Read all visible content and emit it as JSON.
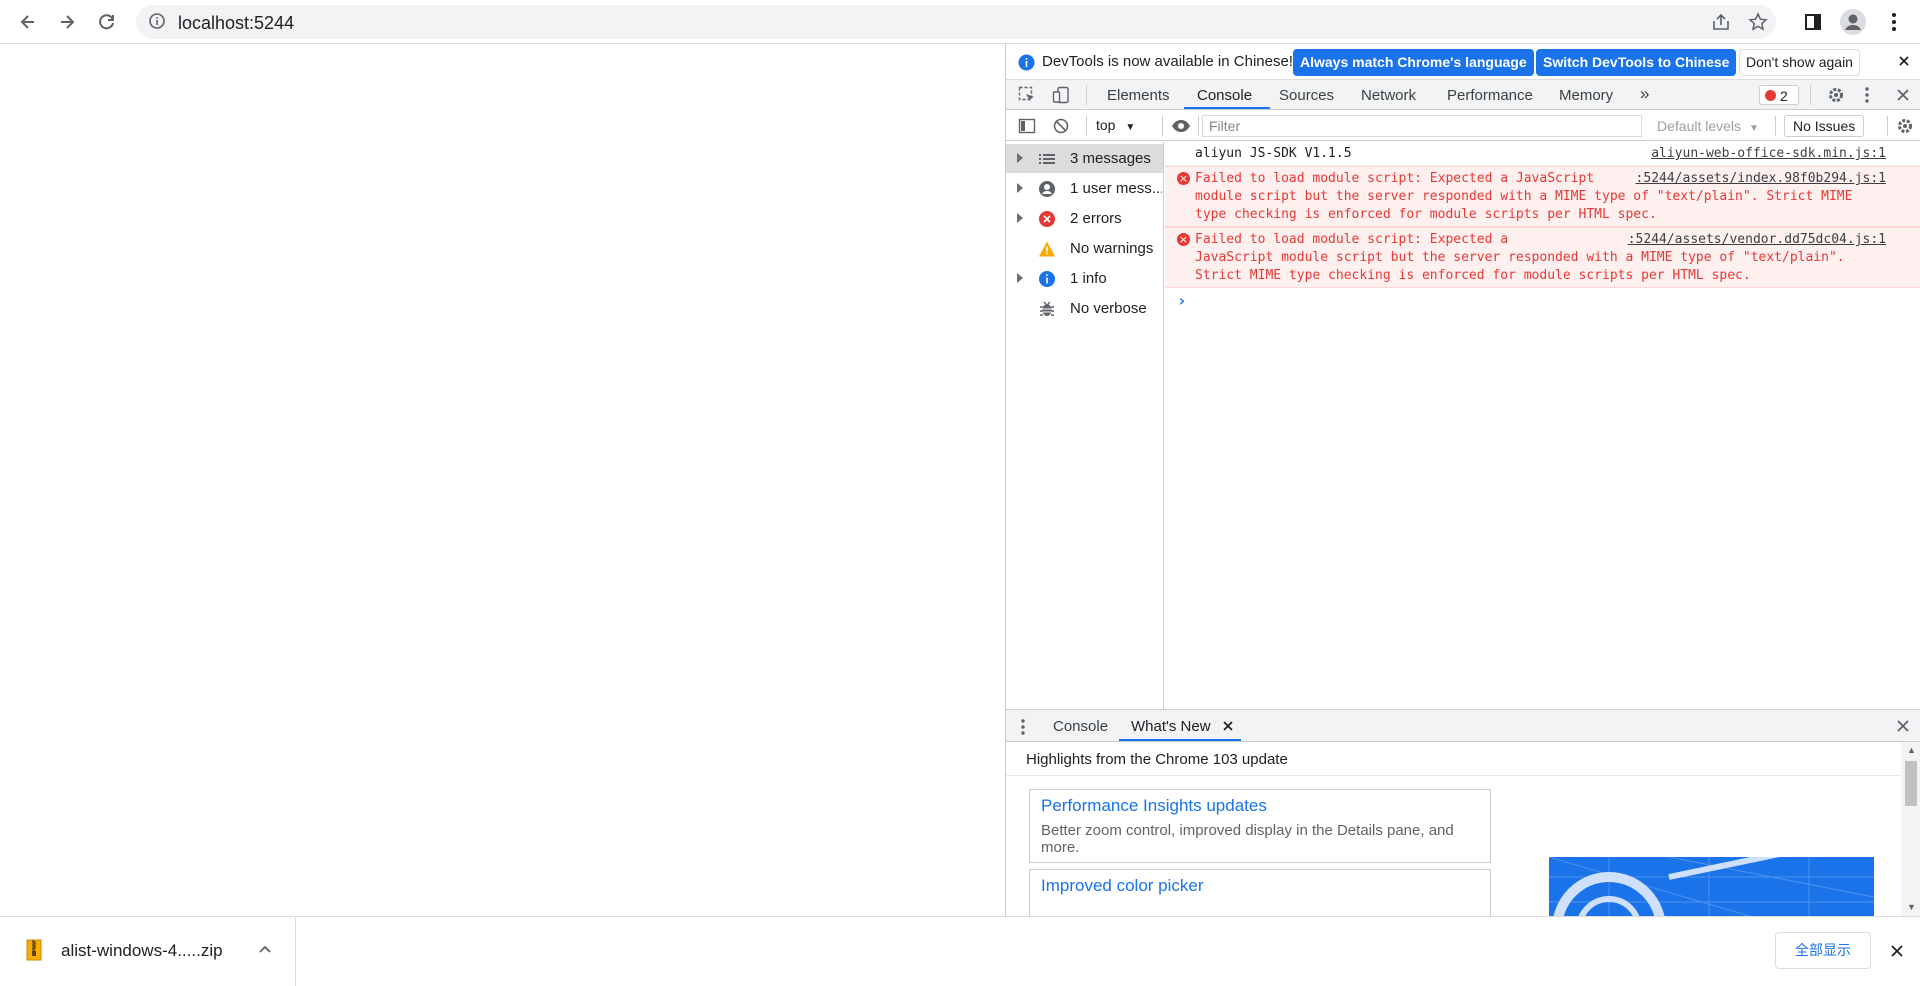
{
  "browser": {
    "url": "localhost:5244",
    "icons": [
      "back-icon",
      "forward-icon",
      "reload-icon",
      "info-icon",
      "share-icon",
      "star-icon",
      "side-panel-icon",
      "profile-icon",
      "menu-icon"
    ]
  },
  "devtools": {
    "infobar": {
      "message": "DevTools is now available in Chinese!",
      "match_button": "Always match Chrome's language",
      "switch_button": "Switch DevTools to Chinese",
      "dismiss_button": "Don't show again"
    },
    "tabs": [
      "Elements",
      "Console",
      "Sources",
      "Network",
      "Performance",
      "Memory"
    ],
    "active_tab": "Console",
    "more_tabs": "»",
    "error_count": "2",
    "console_toolbar": {
      "context": "top",
      "filter_placeholder": "Filter",
      "levels": "Default levels",
      "issues": "No Issues"
    },
    "sidebar": [
      {
        "label": "3 messages",
        "icon": "list-icon",
        "expandable": true
      },
      {
        "label": "1 user mess...",
        "icon": "user-icon",
        "expandable": true
      },
      {
        "label": "2 errors",
        "icon": "error-icon",
        "expandable": true
      },
      {
        "label": "No warnings",
        "icon": "warning-icon",
        "expandable": false
      },
      {
        "label": "1 info",
        "icon": "info-icon",
        "expandable": true
      },
      {
        "label": "No verbose",
        "icon": "bug-icon",
        "expandable": false
      }
    ],
    "log": [
      {
        "type": "log",
        "text": "aliyun JS-SDK V1.1.5",
        "source": "aliyun-web-office-sdk.min.js:1"
      },
      {
        "type": "error",
        "text": "Failed to load module script: Expected a JavaScript\nmodule script but the server responded with a MIME type of \"text/plain\". Strict MIME\ntype checking is enforced for module scripts per HTML spec.",
        "source": ":5244/assets/index.98f0b294.js:1"
      },
      {
        "type": "error",
        "text": "Failed to load module script: Expected a\nJavaScript module script but the server responded with a MIME type of \"text/plain\".\nStrict MIME type checking is enforced for module scripts per HTML spec.",
        "source": ":5244/assets/vendor.dd75dc04.js:1"
      }
    ],
    "prompt": "›",
    "drawer": {
      "tabs": [
        "Console",
        "What's New"
      ],
      "active_tab": "What's New",
      "highlights": "Highlights from the Chrome 103 update",
      "cards": [
        {
          "title": "Performance Insights updates",
          "desc": "Better zoom control, improved display in the Details pane, and more."
        },
        {
          "title": "Improved color picker",
          "desc": ""
        }
      ]
    }
  },
  "download_bar": {
    "file": "alist-windows-4.....zip",
    "show_all": "全部显示"
  },
  "colors": {
    "accent": "#1a73e8",
    "error": "#e53935",
    "warning": "#f9ab00"
  }
}
